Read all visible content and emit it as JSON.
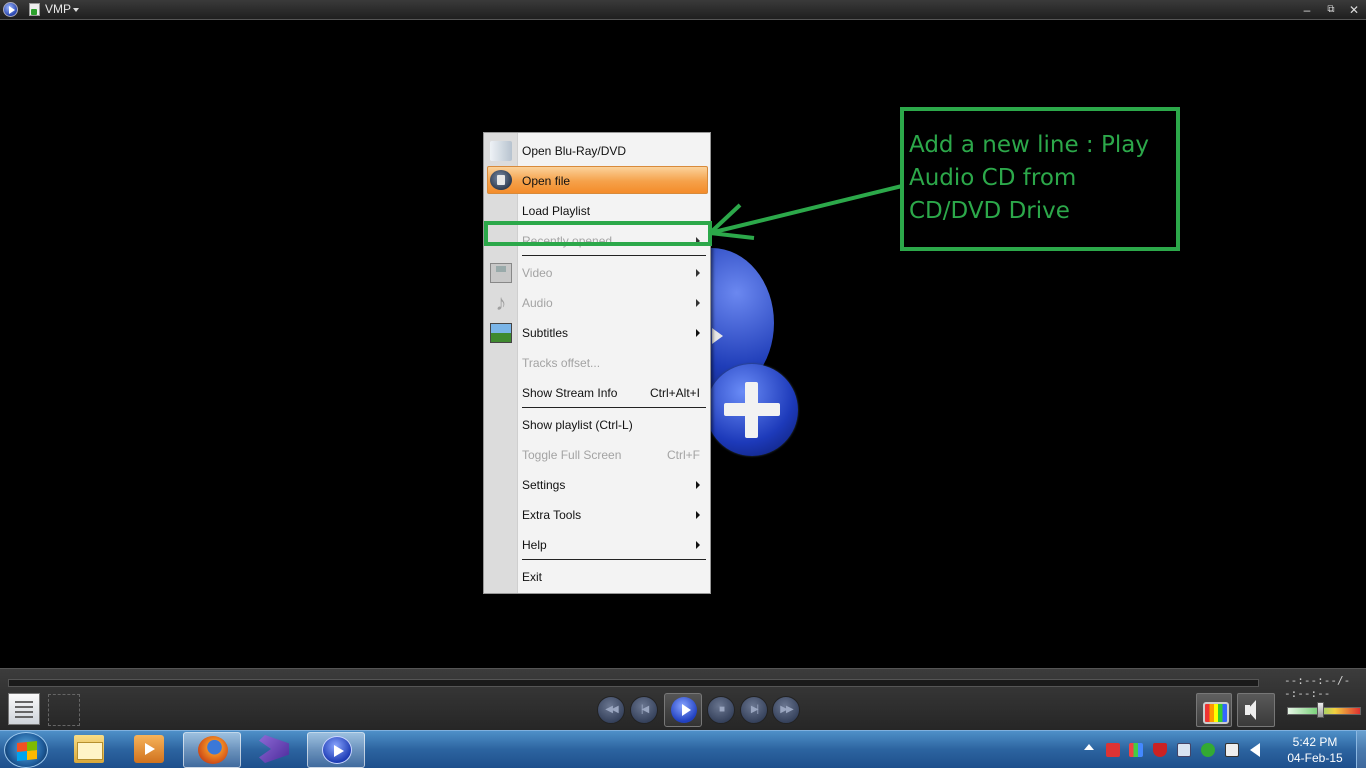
{
  "window": {
    "title": "VMP",
    "controls": {
      "minimize": "–",
      "restore": "⧉",
      "close": "✕"
    }
  },
  "menu": {
    "items": [
      {
        "label": "Open Blu-Ray/DVD",
        "shortcut": "",
        "disabled": false,
        "submenu": false,
        "icon": "disc-icon"
      },
      {
        "label": "Open file",
        "shortcut": "",
        "disabled": false,
        "submenu": false,
        "icon": "open-file-icon",
        "highlighted": true
      },
      {
        "label": "Load Playlist",
        "shortcut": "",
        "disabled": false,
        "submenu": false
      },
      {
        "label": "Recently opened",
        "shortcut": "",
        "disabled": true,
        "submenu": true
      },
      {
        "label": "Video",
        "shortcut": "",
        "disabled": true,
        "submenu": true,
        "icon": "film-icon"
      },
      {
        "label": "Audio",
        "shortcut": "",
        "disabled": true,
        "submenu": true,
        "icon": "music-note-icon"
      },
      {
        "label": "Subtitles",
        "shortcut": "",
        "disabled": false,
        "submenu": true,
        "icon": "picture-icon"
      },
      {
        "label": "Tracks offset...",
        "shortcut": "",
        "disabled": true,
        "submenu": false
      },
      {
        "label": "Show Stream Info",
        "shortcut": "Ctrl+Alt+I",
        "disabled": false,
        "submenu": false
      },
      {
        "label": "Show playlist (Ctrl-L)",
        "shortcut": "",
        "disabled": false,
        "submenu": false
      },
      {
        "label": "Toggle Full Screen",
        "shortcut": "Ctrl+F",
        "disabled": true,
        "submenu": false
      },
      {
        "label": "Settings",
        "shortcut": "",
        "disabled": false,
        "submenu": true
      },
      {
        "label": "Extra Tools",
        "shortcut": "",
        "disabled": false,
        "submenu": true
      },
      {
        "label": "Help",
        "shortcut": "",
        "disabled": false,
        "submenu": true
      },
      {
        "label": "Exit",
        "shortcut": "",
        "disabled": false,
        "submenu": false
      }
    ]
  },
  "annotation": {
    "text": "Add a new line : Play Audio CD from CD/DVD Drive",
    "color": "#2ca84a"
  },
  "player": {
    "time_display": "--:--:--/--:--:--",
    "volume_level": 0.45,
    "transport": [
      {
        "name": "rewind-button",
        "glyph": "◀◀"
      },
      {
        "name": "previous-button",
        "glyph": "|◀"
      },
      {
        "name": "stop-button",
        "glyph": "■"
      },
      {
        "name": "next-button",
        "glyph": "▶|"
      },
      {
        "name": "fast-forward-button",
        "glyph": "▶▶"
      }
    ]
  },
  "taskbar": {
    "apps": [
      {
        "name": "explorer",
        "icon": "folder-icon",
        "active": false
      },
      {
        "name": "media-center",
        "icon": "media-icon",
        "active": false
      },
      {
        "name": "firefox",
        "icon": "firefox-icon",
        "active": true
      },
      {
        "name": "visual-studio",
        "icon": "visual-studio-icon",
        "active": false
      },
      {
        "name": "vmp",
        "icon": "vmp-icon",
        "active": true
      }
    ],
    "clock_time": "5:42 PM",
    "clock_date": "04-Feb-15",
    "tray_icons": [
      "show-hidden-icons-icon",
      "antivirus-icon",
      "network-app-icon",
      "shield-icon",
      "tool-icon",
      "green-app-icon",
      "network-icon",
      "speaker-icon"
    ]
  },
  "colors": {
    "highlight": "#f5a14a",
    "accent_green": "#2ca84a",
    "menu_bg": "#f3f3f3"
  }
}
